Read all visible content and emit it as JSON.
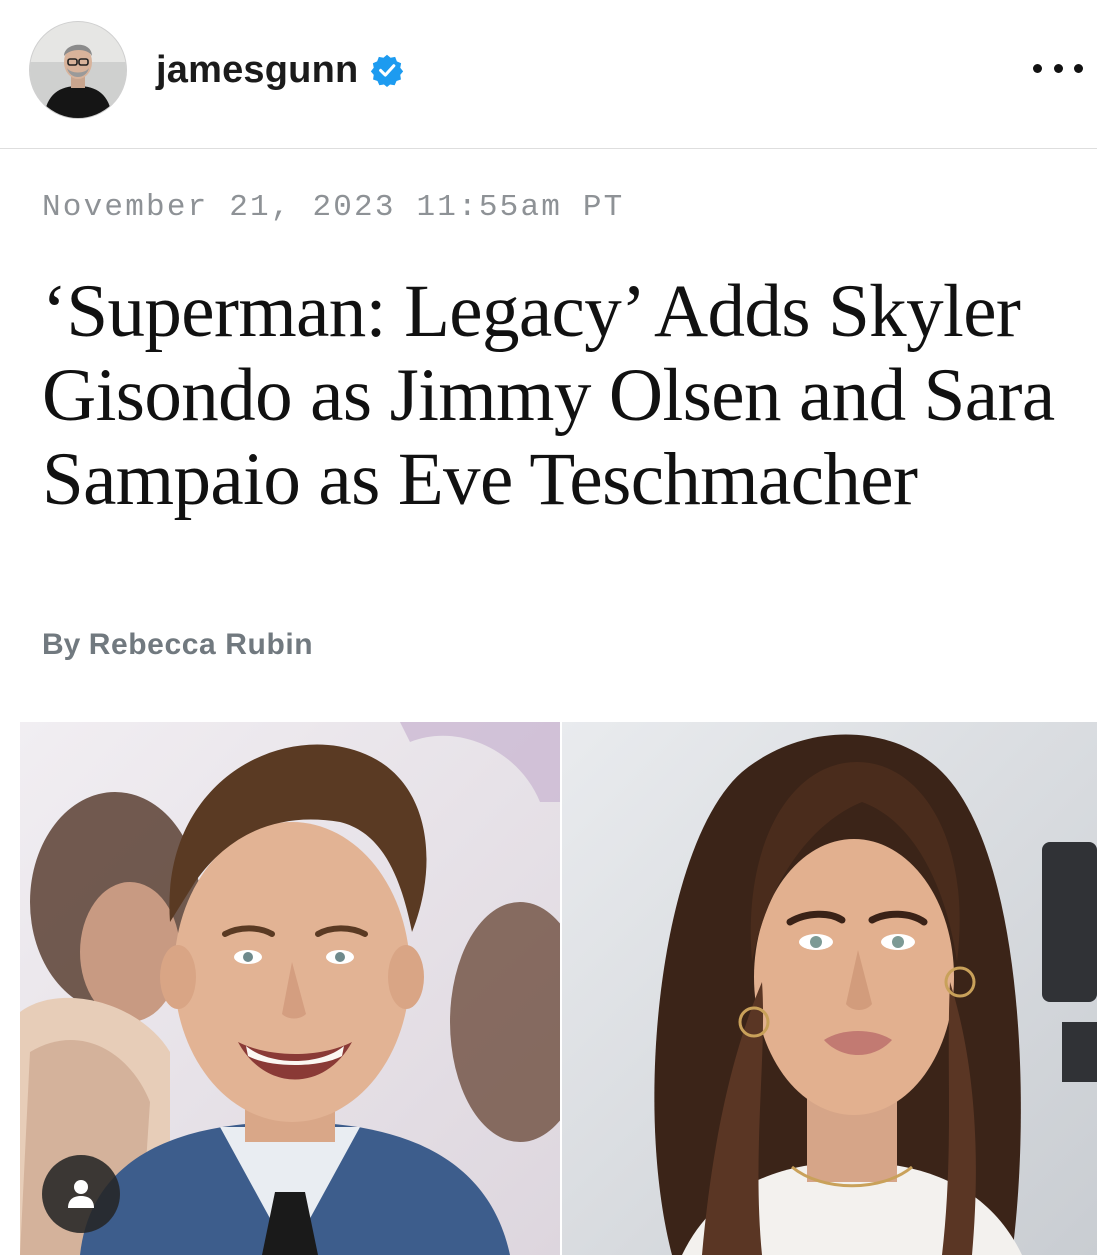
{
  "header": {
    "username": "jamesgunn",
    "verified": true,
    "avatar_icon": "profile-photo",
    "more_icon": "more-horizontal-icon"
  },
  "article": {
    "dateline": "November 21, 2023 11:55am PT",
    "headline": "‘Superman: Legacy’ Adds Skyler Gisondo as Jimmy Olsen and Sara Sampaio as Eve Teschmacher",
    "byline_prefix": "By",
    "byline_author": "Rebecca Rubin"
  },
  "photos": [
    {
      "subject": "man-portrait"
    },
    {
      "subject": "woman-portrait"
    }
  ],
  "tag_button": {
    "icon": "user-tag-icon"
  },
  "colors": {
    "verified_blue": "#1d9bf0",
    "dateline_gray": "#8e9296",
    "byline_gray": "#71797f"
  }
}
